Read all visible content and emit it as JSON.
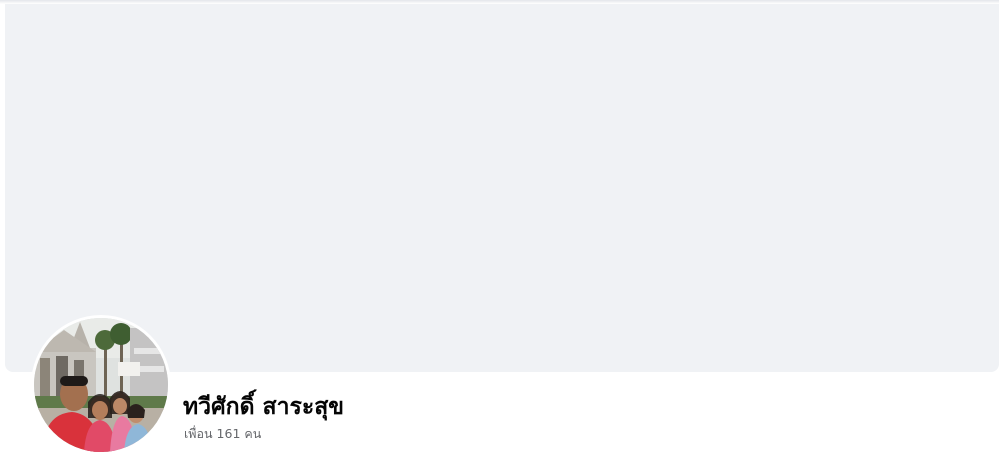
{
  "profile": {
    "name": "ทวีศักดิ์ สาระสุข",
    "friends_count_label": "เพื่อน 161 คน"
  },
  "colors": {
    "cover_background": "#f0f2f5",
    "name_text": "#050505",
    "secondary_text": "#65676b"
  },
  "icons": {
    "avatar": "profile-photo-family-temple"
  }
}
